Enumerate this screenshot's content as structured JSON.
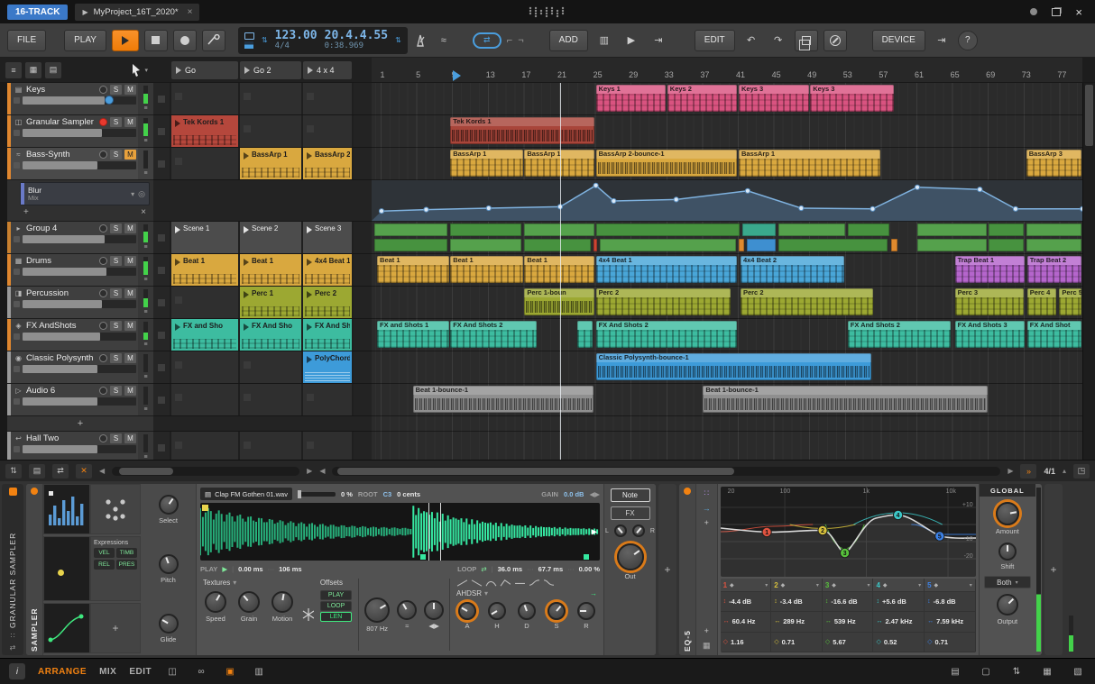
{
  "colors": {
    "accent_orange": "#f28211",
    "accent_blue": "#4a9ede",
    "track_orange": "#e0872f",
    "automation_blue": "#7fb2df",
    "wave_green": "#36e8a2"
  },
  "window": {
    "badge": "16-TRACK",
    "tab_title": "MyProject_16T_2020*",
    "close": "×"
  },
  "toolbar": {
    "file": "FILE",
    "play_menu": "PLAY",
    "tempo": "123.00",
    "time_sig": "4/4",
    "position": "20.4.4.55",
    "time": "0:38.969",
    "add": "ADD",
    "edit": "EDIT",
    "device": "DEVICE",
    "help": "?"
  },
  "scenes": [
    "Go",
    "Go 2",
    "4 x 4"
  ],
  "ruler_beats": [
    1,
    5,
    9,
    13,
    17,
    21,
    25,
    29,
    33,
    37,
    41,
    45,
    49,
    53,
    57,
    61,
    65,
    69,
    73,
    77
  ],
  "playhead_beat": 9,
  "cursor_beat": 21,
  "track_buttons": {
    "solo": "S",
    "mute": "M"
  },
  "device_slot": {
    "title": "Blur",
    "subtitle": "Mix",
    "add": "+",
    "close": "×"
  },
  "add_track_label": "+",
  "rows": [
    {
      "t": "track",
      "i": 0
    },
    {
      "t": "track",
      "i": 1
    },
    {
      "t": "track",
      "i": 2
    },
    {
      "t": "device"
    },
    {
      "t": "track",
      "i": 3
    },
    {
      "t": "track",
      "i": 4
    },
    {
      "t": "track",
      "i": 5
    },
    {
      "t": "track",
      "i": 6
    },
    {
      "t": "track",
      "i": 7
    },
    {
      "t": "track",
      "i": 8
    },
    {
      "t": "add"
    },
    {
      "t": "track",
      "i": 9
    }
  ],
  "tracks": [
    {
      "name": "Keys",
      "color": "#e0872f",
      "icon": "keys",
      "vol": 0.72,
      "meter": 0.55,
      "handle": true,
      "launcher": [
        null,
        null,
        null
      ],
      "arr": [
        {
          "n": "Keys 1",
          "s": 25,
          "l": 8,
          "c": "#d95380",
          "p": "notes"
        },
        {
          "n": "Keys 2",
          "s": 33,
          "l": 8,
          "c": "#d95380",
          "p": "notes"
        },
        {
          "n": "Keys 3",
          "s": 41,
          "l": 8,
          "c": "#d95380",
          "p": "notes"
        },
        {
          "n": "Keys 3",
          "s": 49,
          "l": 9.5,
          "c": "#d95380",
          "p": "notes"
        }
      ]
    },
    {
      "name": "Granular Sampler",
      "color": "#e0872f",
      "icon": "sampler",
      "armed": true,
      "vol": 0.7,
      "meter": 0.7,
      "launcher": [
        {
          "n": "Tek Kords 1",
          "c": "#b5473c",
          "p": "notes"
        },
        null,
        null
      ],
      "arr": [
        {
          "n": "Tek Kords 1",
          "s": 8.7,
          "l": 16.3,
          "c": "#a8453a",
          "p": "wave"
        }
      ]
    },
    {
      "name": "Bass-Synth",
      "color": "#e0872f",
      "icon": "bass",
      "muted": true,
      "selected": true,
      "vol": 0.66,
      "meter": 0,
      "launcher": [
        null,
        {
          "n": "BassArp 1",
          "c": "#d9a83f",
          "p": "notes"
        },
        {
          "n": "BassArp 2",
          "c": "#d9a83f",
          "p": "notes"
        }
      ],
      "arr": [
        {
          "n": "BassArp 1",
          "s": 8.7,
          "l": 8.3,
          "c": "#d9a83f",
          "p": "notes"
        },
        {
          "n": "BassArp 1",
          "s": 17,
          "l": 8,
          "c": "#d9a83f",
          "p": "notes"
        },
        {
          "n": "BassArp 2-bounce-1",
          "s": 25,
          "l": 16,
          "c": "#d9a83f",
          "p": "wave"
        },
        {
          "n": "BassArp 1",
          "s": 41,
          "l": 16,
          "c": "#d9a83f",
          "p": "notes"
        },
        {
          "n": "BassArp 3",
          "s": 73.2,
          "l": 6.3,
          "c": "#d9a83f",
          "p": "notes"
        }
      ]
    },
    {
      "name": "Group 4",
      "color": "#c8802f",
      "icon": "group",
      "vol": 0.72,
      "meter": 0.6,
      "launcher": [
        {
          "n": "Scene 1",
          "scene": true
        },
        {
          "n": "Scene 2",
          "scene": true
        },
        {
          "n": "Scene 3",
          "scene": true
        }
      ],
      "arr": [],
      "lanes": [
        [
          [
            0.2,
            8.3,
            "#55a14c"
          ],
          [
            8.7,
            8.1,
            "#47923f"
          ],
          [
            17,
            7.9,
            "#55a14c"
          ],
          [
            25,
            16.2,
            "#47923f"
          ],
          [
            41.4,
            3.8,
            "#3aa98c"
          ],
          [
            45.4,
            7.6,
            "#55a14c"
          ],
          [
            53.2,
            4.8,
            "#47923f"
          ],
          [
            61,
            7.9,
            "#55a14c"
          ],
          [
            69,
            4,
            "#47923f"
          ],
          [
            73.2,
            6.3,
            "#55a14c"
          ]
        ],
        [
          [
            0.2,
            8.3,
            "#47923f"
          ],
          [
            8.7,
            8.1,
            "#55a14c"
          ],
          [
            17,
            7.5,
            "#47923f"
          ],
          [
            24.7,
            0.5,
            "#cc4433"
          ],
          [
            25.4,
            15.4,
            "#55a14c"
          ],
          [
            41,
            0.7,
            "#e08a2e"
          ],
          [
            41.9,
            3.3,
            "#3e8fd0"
          ],
          [
            45.4,
            12.4,
            "#47923f"
          ],
          [
            58.1,
            0.8,
            "#e08a2e"
          ],
          [
            61,
            7.9,
            "#55a14c"
          ],
          [
            69,
            4,
            "#47923f"
          ],
          [
            73.2,
            6.3,
            "#55a14c"
          ]
        ]
      ]
    },
    {
      "name": "Drums",
      "color": "#e0872f",
      "icon": "drums",
      "vol": 0.74,
      "meter": 0.75,
      "launcher": [
        {
          "n": "Beat 1",
          "c": "#d9a83f",
          "p": "notes"
        },
        {
          "n": "Beat 1",
          "c": "#d9a83f",
          "p": "notes"
        },
        {
          "n": "4x4 Beat 1",
          "c": "#d9a83f",
          "p": "notes"
        }
      ],
      "arr": [
        {
          "n": "Beat 1",
          "s": 0.5,
          "l": 8.2,
          "c": "#d9a83f",
          "p": "notes"
        },
        {
          "n": "Beat 1",
          "s": 8.7,
          "l": 8.3,
          "c": "#d9a83f",
          "p": "notes"
        },
        {
          "n": "Beat 1",
          "s": 17,
          "l": 8,
          "c": "#d9a83f",
          "p": "notes"
        },
        {
          "n": "4x4 Beat 1",
          "s": 25,
          "l": 16,
          "c": "#49a6d8",
          "p": "notes"
        },
        {
          "n": "4x4 Beat 2",
          "s": 41.2,
          "l": 11.8,
          "c": "#49a6d8",
          "p": "notes"
        },
        {
          "n": "Trap Beat 1",
          "s": 65.2,
          "l": 8,
          "c": "#b565cc",
          "p": "notes"
        },
        {
          "n": "Trap Beat 2",
          "s": 73.3,
          "l": 6.2,
          "c": "#b565cc",
          "p": "notes"
        }
      ]
    },
    {
      "name": "Percussion",
      "color": "#9a9a9a",
      "icon": "perc",
      "vol": 0.7,
      "meter": 0.5,
      "launcher": [
        null,
        {
          "n": "Perc 1",
          "c": "#9ca832",
          "p": "notes"
        },
        {
          "n": "Perc 2",
          "c": "#9ca832",
          "p": "notes"
        }
      ],
      "arr": [
        {
          "n": "Perc 1-boun",
          "s": 17,
          "l": 8,
          "c": "#9ca832",
          "p": "wave"
        },
        {
          "n": "Perc 2",
          "s": 25,
          "l": 15.2,
          "c": "#9ca832",
          "p": "notes"
        },
        {
          "n": "Perc 2",
          "s": 41.2,
          "l": 15,
          "c": "#9ca832",
          "p": "notes"
        },
        {
          "n": "Perc 3",
          "s": 65.2,
          "l": 7.9,
          "c": "#9ca832",
          "p": "notes"
        },
        {
          "n": "Perc 4",
          "s": 73.3,
          "l": 3.4,
          "c": "#9ca832",
          "p": "notes"
        },
        {
          "n": "Perc 5",
          "s": 76.9,
          "l": 2.6,
          "c": "#9ca832",
          "p": "notes"
        }
      ]
    },
    {
      "name": "FX AndShots",
      "color": "#e0872f",
      "icon": "fx",
      "vol": 0.68,
      "meter": 0.4,
      "launcher": [
        {
          "n": "FX and Sho",
          "c": "#3dbca0",
          "p": "notes"
        },
        {
          "n": "FX And Sho",
          "c": "#3dbca0",
          "p": "notes"
        },
        {
          "n": "FX And Sh",
          "c": "#3dbca0",
          "p": "notes"
        }
      ],
      "arr": [
        {
          "n": "FX and Shots 1",
          "s": 0.5,
          "l": 8.2,
          "c": "#3dbca0",
          "p": "notes"
        },
        {
          "n": "FX And Shots 2",
          "s": 8.7,
          "l": 9.8,
          "c": "#3dbca0",
          "p": "notes"
        },
        {
          "n": "",
          "s": 22.9,
          "l": 1.9,
          "c": "#3dbca0",
          "p": "notes"
        },
        {
          "n": "FX And Shots 2",
          "s": 25,
          "l": 16,
          "c": "#3dbca0",
          "p": "notes"
        },
        {
          "n": "FX And Shots 2",
          "s": 53.2,
          "l": 11.7,
          "c": "#3dbca0",
          "p": "notes"
        },
        {
          "n": "FX And Shots 3",
          "s": 65.2,
          "l": 8,
          "c": "#3dbca0",
          "p": "notes"
        },
        {
          "n": "FX And Shot",
          "s": 73.3,
          "l": 6.2,
          "c": "#3dbca0",
          "p": "notes"
        }
      ]
    },
    {
      "name": "Classic Polysynth",
      "color": "#9a9a9a",
      "icon": "synth",
      "vol": 0.66,
      "meter": 0,
      "launcher": [
        null,
        null,
        {
          "n": "PolyChords",
          "c": "#3d9bd9",
          "p": "wave"
        }
      ],
      "arr": [
        {
          "n": "Classic Polysynth-bounce-1",
          "s": 25,
          "l": 31,
          "c": "#3d9bd9",
          "p": "wave"
        }
      ]
    },
    {
      "name": "Audio 6",
      "color": "#9a9a9a",
      "icon": "audio",
      "vol": 0.66,
      "meter": 0,
      "launcher": [
        null,
        null,
        null
      ],
      "arr": [
        {
          "n": "Beat 1-bounce-1",
          "s": 4.5,
          "l": 20.4,
          "c": "#8f8f8f",
          "p": "wave"
        },
        {
          "n": "Beat 1-bounce-1",
          "s": 37,
          "l": 32,
          "c": "#8f8f8f",
          "p": "wave"
        }
      ]
    },
    {
      "name": "Hall Two",
      "color": "#9a9a9a",
      "icon": "return",
      "vol": 0.66,
      "meter": 0,
      "launcher": [
        null,
        null,
        null
      ],
      "arr": []
    }
  ],
  "automation": {
    "points": [
      [
        1,
        0.22
      ],
      [
        6,
        0.26
      ],
      [
        13,
        0.3
      ],
      [
        21,
        0.34
      ],
      [
        25,
        0.93
      ],
      [
        27,
        0.5
      ],
      [
        34,
        0.54
      ],
      [
        42,
        0.78
      ],
      [
        48,
        0.3
      ],
      [
        56,
        0.28
      ],
      [
        61,
        0.88
      ],
      [
        68,
        0.82
      ],
      [
        72,
        0.28
      ],
      [
        79.5,
        0.28
      ]
    ]
  },
  "footer": {
    "zoom": "4/1"
  },
  "device_panel": {
    "track_label": "GRANULAR SAMPLER",
    "add_slot": "+",
    "sampler": {
      "name": "SAMPLER",
      "file": "Clap FM Gothen 01.wav",
      "stretch": "0 %",
      "root_label": "ROOT",
      "root": "C3",
      "cents": "0 cents",
      "gain_label": "GAIN",
      "gain": "0.0 dB",
      "play_label": "PLAY",
      "play_start": "0.00 ms",
      "play_len": "106 ms",
      "loop_label": "LOOP",
      "loop_start": "36.0 ms",
      "loop_len": "67.7 ms",
      "loop_xfade": "0.00 %",
      "textures_label": "Textures",
      "texture_knobs": [
        "Speed",
        "Grain",
        "Motion"
      ],
      "offsets_label": "Offsets",
      "offsets": [
        "PLAY",
        "LOOP",
        "LEN"
      ],
      "offsets_on": "LEN",
      "filter_freq": "807 Hz",
      "ahdsr_label": "AHDSR",
      "env_knobs": [
        "A",
        "H",
        "D",
        "S",
        "R"
      ],
      "note_tab": "Note",
      "fx_tab": "FX",
      "out_label": "Out",
      "select_label": "Select",
      "pitch_label": "Pitch",
      "glide_label": "Glide",
      "expressions_label": "Expressions",
      "expr_buttons": [
        "VEL",
        "TIMB",
        "REL",
        "PRES"
      ]
    },
    "eq": {
      "name": "EQ-5",
      "freq_grid": [
        "20",
        "100",
        "1k",
        "10k"
      ],
      "db_grid": [
        "+10",
        "-10",
        "-20"
      ],
      "bands": [
        {
          "num": "1",
          "gain": "-4.4 dB",
          "freq": "60.4 Hz",
          "q": "1.16",
          "color": "#e05340"
        },
        {
          "num": "2",
          "gain": "-3.4 dB",
          "freq": "289 Hz",
          "q": "0.71",
          "color": "#d8c23c"
        },
        {
          "num": "3",
          "gain": "-16.6 dB",
          "freq": "539 Hz",
          "q": "5.67",
          "color": "#58c23c"
        },
        {
          "num": "4",
          "gain": "+5.6 dB",
          "freq": "2.47 kHz",
          "q": "0.52",
          "color": "#3cc8c8"
        },
        {
          "num": "5",
          "gain": "-6.8 dB",
          "freq": "7.59 kHz",
          "q": "0.71",
          "color": "#3c82e8"
        }
      ],
      "global_label": "GLOBAL",
      "amount_label": "Amount",
      "shift_label": "Shift",
      "mode": "Both",
      "output_label": "Output"
    }
  },
  "statusbar": {
    "info": "i",
    "tabs": [
      "ARRANGE",
      "MIX",
      "EDIT"
    ],
    "active": "ARRANGE"
  }
}
